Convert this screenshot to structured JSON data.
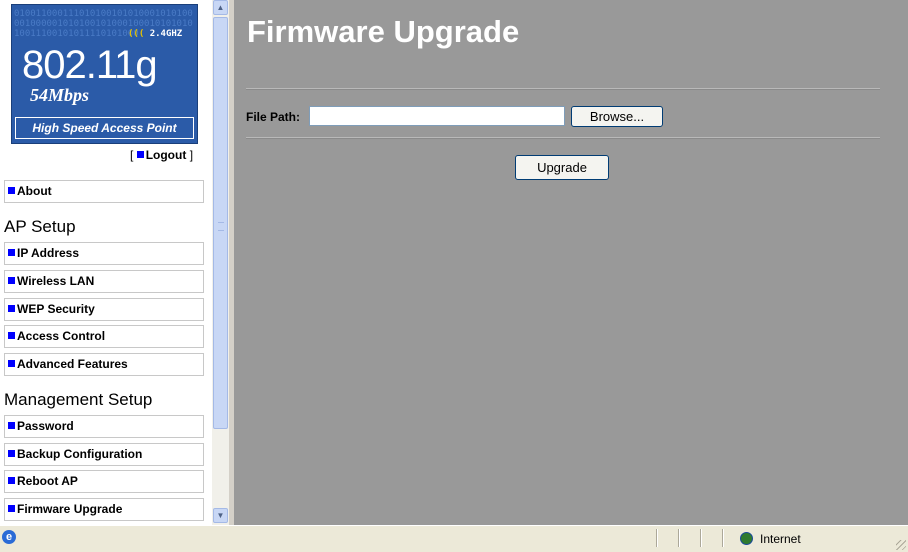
{
  "logo": {
    "bits": "01001100011101010010101000101010000100000101010010100010001010101010011100101011110101000",
    "band_waves": "(((",
    "band": "2.4GHZ",
    "standard": "802.11g",
    "speed": "54Mbps",
    "tagline": "High Speed Access Point"
  },
  "logout": {
    "bracket_open": "[",
    "label": "Logout",
    "bracket_close": "]"
  },
  "nav": {
    "about": "About",
    "ap_setup_heading": "AP Setup",
    "ap_setup": [
      "IP Address",
      "Wireless LAN",
      "WEP Security",
      "Access Control",
      "Advanced Features"
    ],
    "management_heading": "Management Setup",
    "management": [
      "Password",
      "Backup Configuration",
      "Reboot AP",
      "Firmware Upgrade"
    ]
  },
  "main": {
    "title": "Firmware Upgrade",
    "file_path_label": "File Path:",
    "file_path_value": "",
    "browse_label": "Browse...",
    "upgrade_label": "Upgrade"
  },
  "status_bar": {
    "zone": "Internet"
  },
  "colors": {
    "main_bg": "#999999",
    "logo_bg": "#2b5ba8",
    "bullet": "#0000ff"
  }
}
